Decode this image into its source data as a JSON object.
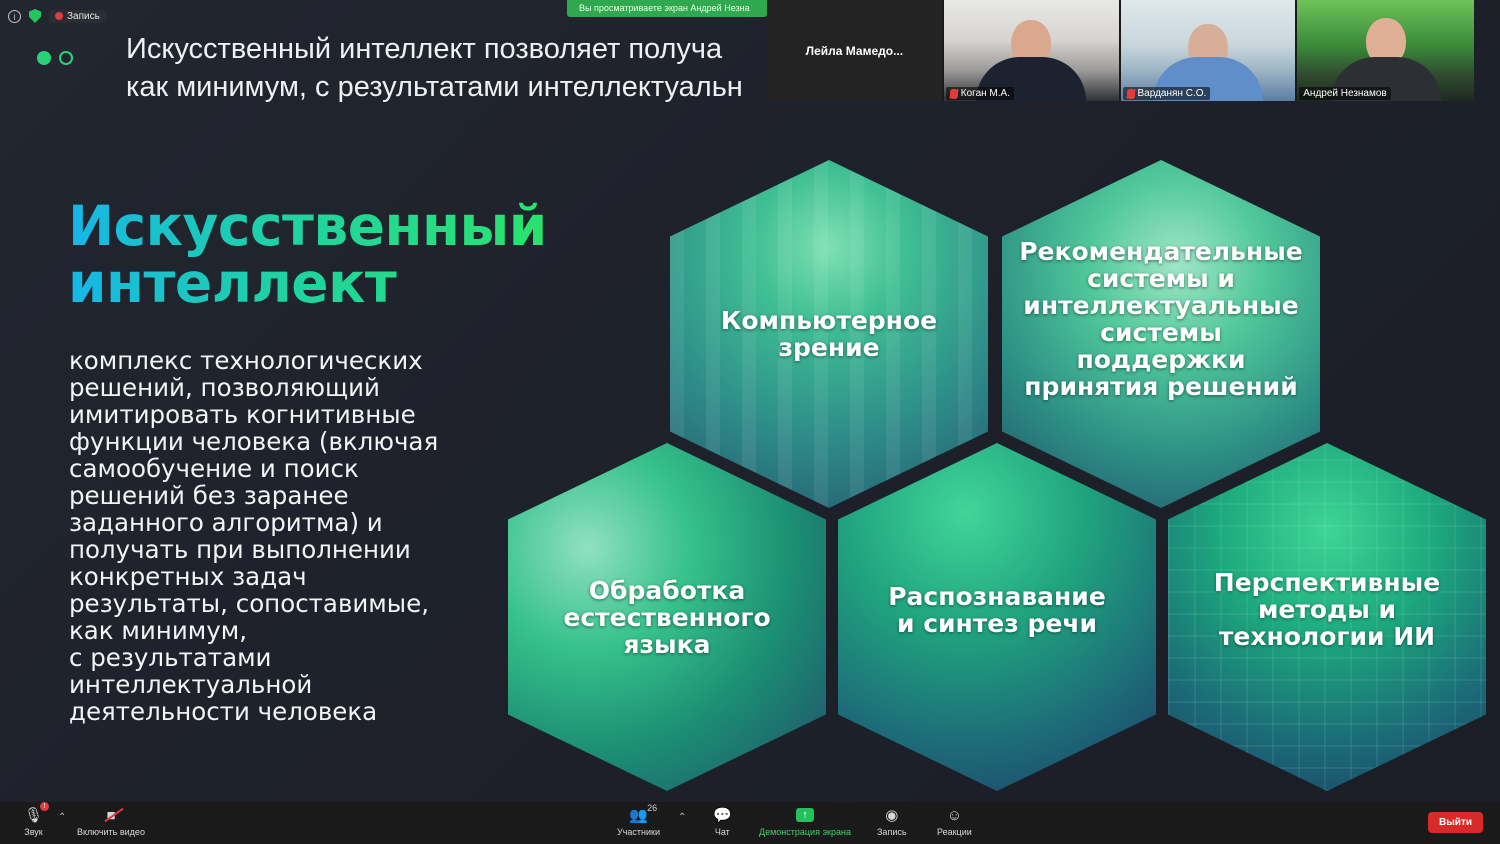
{
  "status": {
    "recording_label": "Запись",
    "banner_text": "Вы просматриваете экран Андрей Незна"
  },
  "slide": {
    "header_line1": "Искусственный интеллект позволяет получа",
    "header_line2": "как минимум, с результатами интеллектуальн",
    "title_line1": "Искусственный",
    "title_line2": "интеллект",
    "body_lines": [
      "комплекс технологических",
      "решений, позволяющий",
      "имитировать когнитивные",
      "функции человека (включая",
      "самообучение и поиск",
      "решений без заранее",
      "заданного алгоритма) и",
      "получать при выполнении",
      "конкретных задач",
      "результаты, сопоставимые,",
      "как минимум,",
      "с результатами",
      "интеллектуальной",
      "деятельности человека"
    ],
    "hexagons": [
      {
        "lines": [
          "Компьютерное",
          "зрение"
        ]
      },
      {
        "lines": [
          "Рекомендательные",
          "системы и",
          "интеллектуальные",
          "системы поддержки",
          "принятия решений"
        ]
      },
      {
        "lines": [
          "Обработка",
          "естественного",
          "языка"
        ]
      },
      {
        "lines": [
          "Распознавание",
          "и синтез речи"
        ]
      },
      {
        "lines": [
          "Перспективные",
          "методы и",
          "технологии ИИ"
        ]
      }
    ],
    "accent_colors": [
      "#16b6e8",
      "#2ae36d",
      "#29d178"
    ]
  },
  "participants": {
    "name_tile": "Лейла  Мамедо...",
    "videos": [
      {
        "name": "Коган М.А.",
        "muted": true
      },
      {
        "name": "Варданян С.О.",
        "muted": true
      },
      {
        "name": "Андрей Незнамов",
        "muted": false
      }
    ]
  },
  "toolbar": {
    "audio": "Звук",
    "video": "Включить видео",
    "participants": "Участники",
    "participants_count": "26",
    "chat": "Чат",
    "share": "Демонстрация экрана",
    "record": "Запись",
    "reactions": "Реакции",
    "leave": "Выйти"
  }
}
